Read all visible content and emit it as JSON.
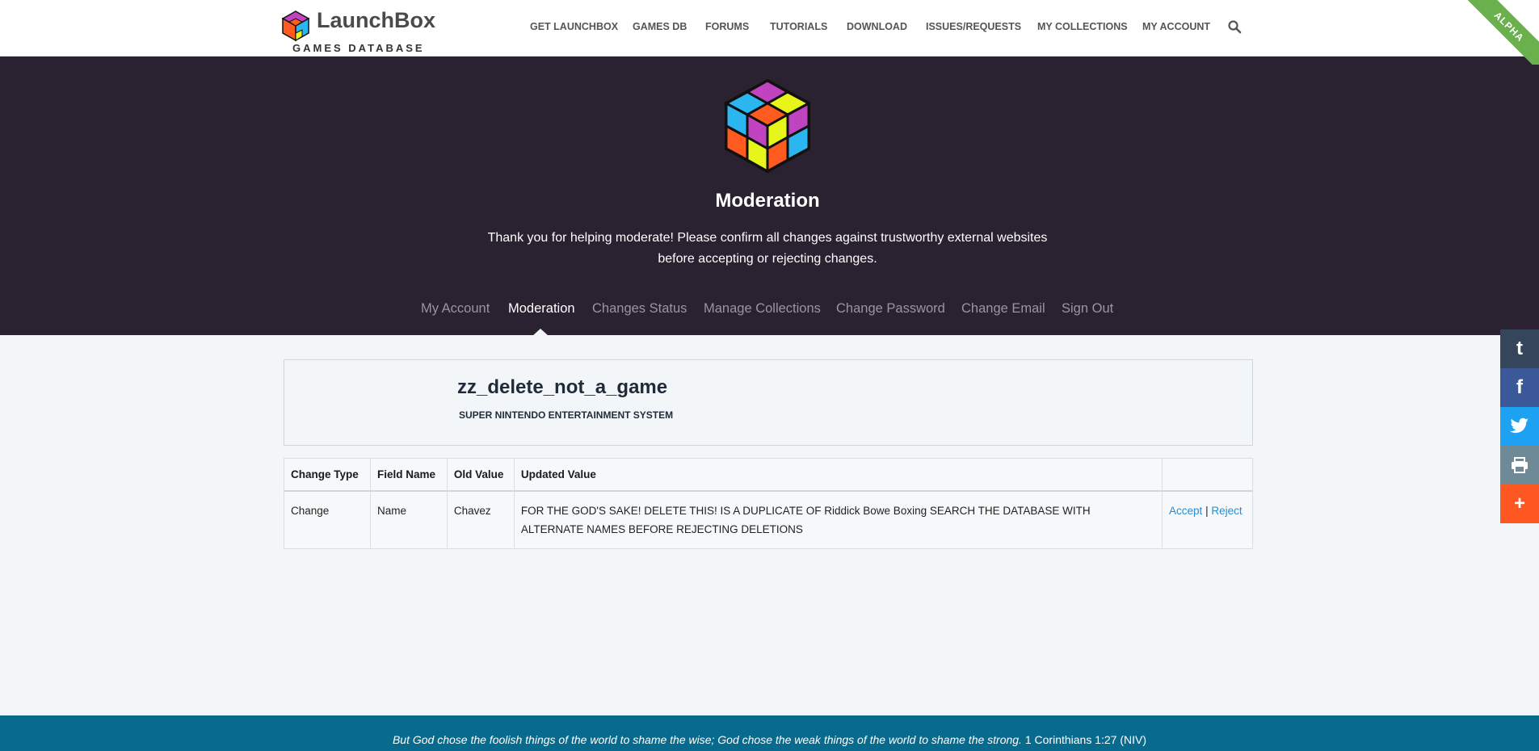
{
  "header": {
    "brand": "LaunchBox",
    "subtitle": "GAMES DATABASE",
    "nav": [
      {
        "label": "GET LAUNCHBOX"
      },
      {
        "label": "GAMES DB"
      },
      {
        "label": "FORUMS"
      },
      {
        "label": "TUTORIALS"
      },
      {
        "label": "DOWNLOAD"
      },
      {
        "label": "ISSUES/REQUESTS"
      },
      {
        "label": "MY COLLECTIONS"
      },
      {
        "label": "MY ACCOUNT"
      }
    ],
    "search_icon": "search-icon",
    "ribbon": "ALPHA"
  },
  "hero": {
    "title": "Moderation",
    "description": "Thank you for helping moderate! Please confirm all changes against trustworthy external websites before accepting or rejecting changes.",
    "tabs": [
      {
        "label": "My Account"
      },
      {
        "label": "Moderation"
      },
      {
        "label": "Changes Status"
      },
      {
        "label": "Manage Collections"
      },
      {
        "label": "Change Password"
      },
      {
        "label": "Change Email"
      },
      {
        "label": "Sign Out"
      }
    ],
    "active_tab": "Moderation"
  },
  "game": {
    "title": "zz_delete_not_a_game",
    "platform": "SUPER NINTENDO ENTERTAINMENT SYSTEM"
  },
  "table": {
    "headers": [
      "Change Type",
      "Field Name",
      "Old Value",
      "Updated Value",
      ""
    ],
    "rows": [
      {
        "change_type": "Change",
        "field_name": "Name",
        "old_value": "Chavez",
        "updated_value": "FOR THE GOD'S SAKE! DELETE THIS! IS A DUPLICATE OF Riddick Bowe Boxing SEARCH THE DATABASE WITH ALTERNATE NAMES BEFORE REJECTING DELETIONS",
        "accept": "Accept",
        "separator": "|",
        "reject": "Reject"
      }
    ]
  },
  "share": [
    {
      "icon": "tumblr-icon",
      "glyph": "t",
      "color": "#35465c"
    },
    {
      "icon": "facebook-icon",
      "glyph": "f",
      "color": "#3b5998"
    },
    {
      "icon": "twitter-icon",
      "glyph": "🐦",
      "color": "#1da1f2"
    },
    {
      "icon": "print-icon",
      "glyph": "⎙",
      "color": "#6d8a96"
    },
    {
      "icon": "more-icon",
      "glyph": "+",
      "color": "#ff5722"
    }
  ],
  "footer": {
    "quote": "But God chose the foolish things of the world to shame the wise; God chose the weak things of the world to shame the strong.",
    "reference": "1 Corinthians 1:27 (NIV)"
  }
}
